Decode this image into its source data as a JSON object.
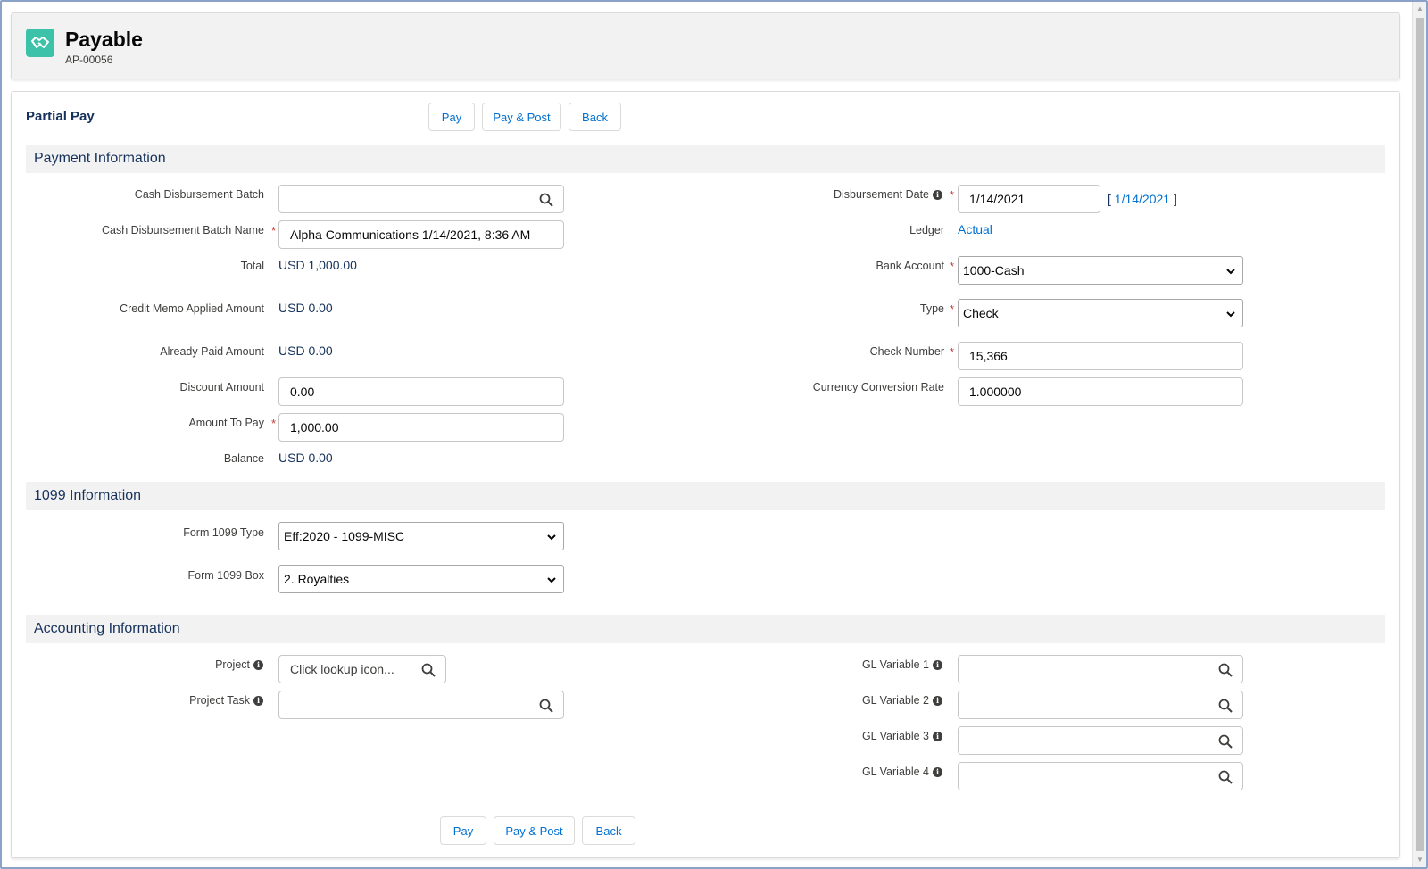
{
  "header": {
    "title": "Payable",
    "record_number": "AP-00056",
    "icon": "handshake-icon"
  },
  "card": {
    "title": "Partial Pay",
    "buttons": {
      "pay": "Pay",
      "pay_post": "Pay & Post",
      "back": "Back"
    }
  },
  "sections": {
    "payment": "Payment Information",
    "form1099": "1099 Information",
    "accounting": "Accounting Information"
  },
  "payment": {
    "cash_disbursement_batch": {
      "label": "Cash Disbursement Batch",
      "value": ""
    },
    "batch_name": {
      "label": "Cash Disbursement Batch Name",
      "value": "Alpha Communications 1/14/2021, 8:36 AM"
    },
    "total": {
      "label": "Total",
      "value": "USD 1,000.00"
    },
    "credit_memo": {
      "label": "Credit Memo Applied Amount",
      "value": "USD 0.00"
    },
    "already_paid": {
      "label": "Already Paid Amount",
      "value": "USD 0.00"
    },
    "discount": {
      "label": "Discount Amount",
      "value": "0.00"
    },
    "amount_to_pay": {
      "label": "Amount To Pay",
      "value": "1,000.00"
    },
    "balance": {
      "label": "Balance",
      "value": "USD 0.00"
    },
    "disbursement_date": {
      "label": "Disbursement Date",
      "value": "1/14/2021",
      "today_link": "1/14/2021",
      "bracket_open": "[",
      "bracket_close": "]"
    },
    "ledger": {
      "label": "Ledger",
      "value": "Actual"
    },
    "bank_account": {
      "label": "Bank Account",
      "value": "1000-Cash"
    },
    "type": {
      "label": "Type",
      "value": "Check"
    },
    "check_number": {
      "label": "Check Number",
      "value": "15,366"
    },
    "conversion_rate": {
      "label": "Currency Conversion Rate",
      "value": "1.000000"
    }
  },
  "form1099": {
    "type": {
      "label": "Form 1099 Type",
      "value": "Eff:2020 - 1099-MISC"
    },
    "box": {
      "label": "Form 1099 Box",
      "value": "2. Royalties"
    }
  },
  "accounting": {
    "project": {
      "label": "Project",
      "placeholder": "Click lookup icon..."
    },
    "project_task": {
      "label": "Project Task",
      "value": ""
    },
    "gl1": {
      "label": "GL Variable 1",
      "value": ""
    },
    "gl2": {
      "label": "GL Variable 2",
      "value": ""
    },
    "gl3": {
      "label": "GL Variable 3",
      "value": ""
    },
    "gl4": {
      "label": "GL Variable 4",
      "value": ""
    }
  },
  "info_glyph": "i",
  "required_mark": "*",
  "colors": {
    "brand_icon": "#3bc2a9",
    "link": "#0070d2",
    "section_bg": "#f3f2f2",
    "required": "#c23934"
  }
}
